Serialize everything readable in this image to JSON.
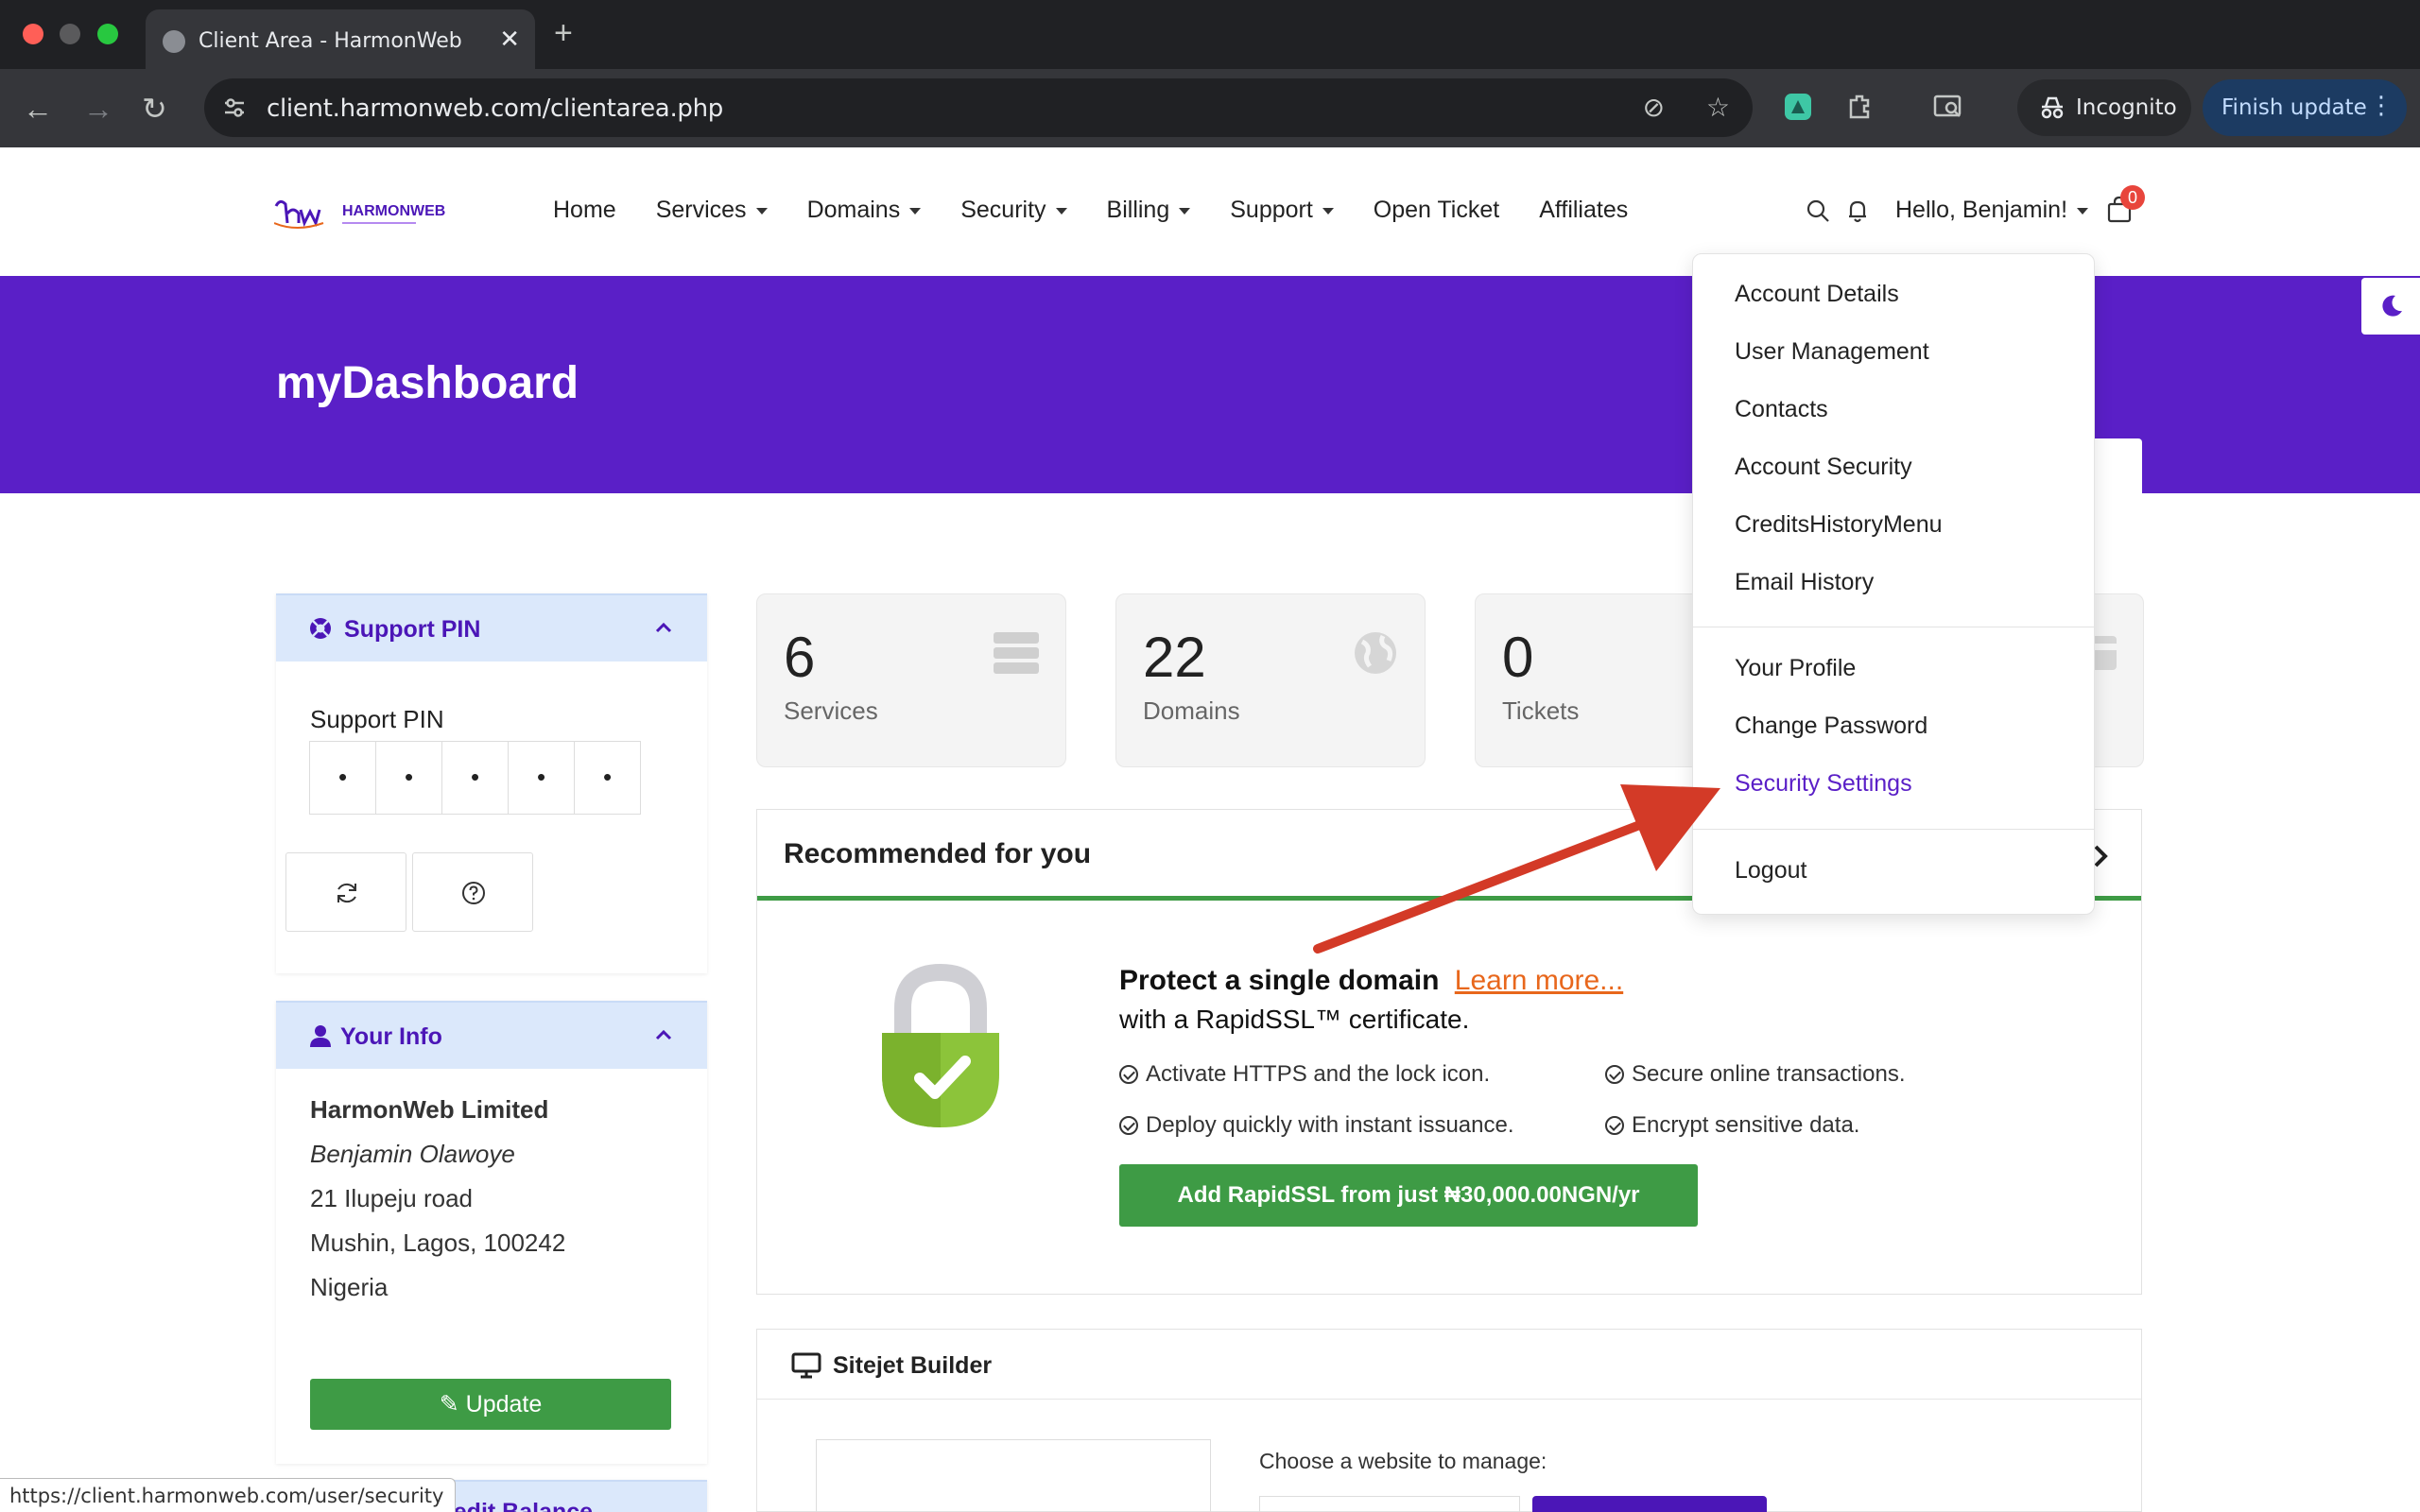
{
  "browser": {
    "tab_title": "Client Area - HarmonWeb",
    "url": "client.harmonweb.com/clientarea.php",
    "incognito_label": "Incognito",
    "finish_update_label": "Finish update",
    "status_url": "https://client.harmonweb.com/user/security"
  },
  "header": {
    "logo_text": "HARMONWEB",
    "nav": [
      "Home",
      "Services",
      "Domains",
      "Security",
      "Billing",
      "Support",
      "Open Ticket",
      "Affiliates"
    ],
    "greeting": "Hello, Benjamin!",
    "cart_count": "0"
  },
  "banner": {
    "title": "myDashboard"
  },
  "support_pin": {
    "title": "Support PIN",
    "label": "Support PIN",
    "digits": [
      "•",
      "•",
      "•",
      "•",
      "•"
    ]
  },
  "your_info": {
    "title": "Your Info",
    "company": "HarmonWeb Limited",
    "name": "Benjamin Olawoye",
    "address1": "21 Ilupeju road",
    "address2": "Mushin, Lagos, 100242",
    "country": "Nigeria",
    "update_label": "Update"
  },
  "next_panel_title": "Credit Balance",
  "stats": [
    {
      "number": "6",
      "label": "Services"
    },
    {
      "number": "22",
      "label": "Domains"
    },
    {
      "number": "0",
      "label": "Tickets"
    }
  ],
  "recommended": {
    "title": "Recommended for you",
    "promo_title": "Protect a single domain",
    "learn_more": "Learn more...",
    "promo_sub": "with a RapidSSL™ certificate.",
    "features": [
      "Activate HTTPS and the lock icon.",
      "Secure online transactions.",
      "Deploy quickly with instant issuance.",
      "Encrypt sensitive data."
    ],
    "button": "Add RapidSSL from just ₦30,000.00NGN/yr"
  },
  "sitejet": {
    "title": "Sitejet Builder",
    "choose_label": "Choose a website to manage:"
  },
  "account_menu": {
    "group1": [
      "Account Details",
      "User Management",
      "Contacts",
      "Account Security",
      "CreditsHistoryMenu",
      "Email History"
    ],
    "group2": [
      "Your Profile",
      "Change Password",
      "Security Settings"
    ],
    "logout": "Logout",
    "active_item": "Security Settings"
  },
  "colors": {
    "brand_purple": "#5a1fc7",
    "accent_green": "#3e9b45",
    "link_orange": "#e8671c",
    "annotation_red": "#d33a27"
  }
}
